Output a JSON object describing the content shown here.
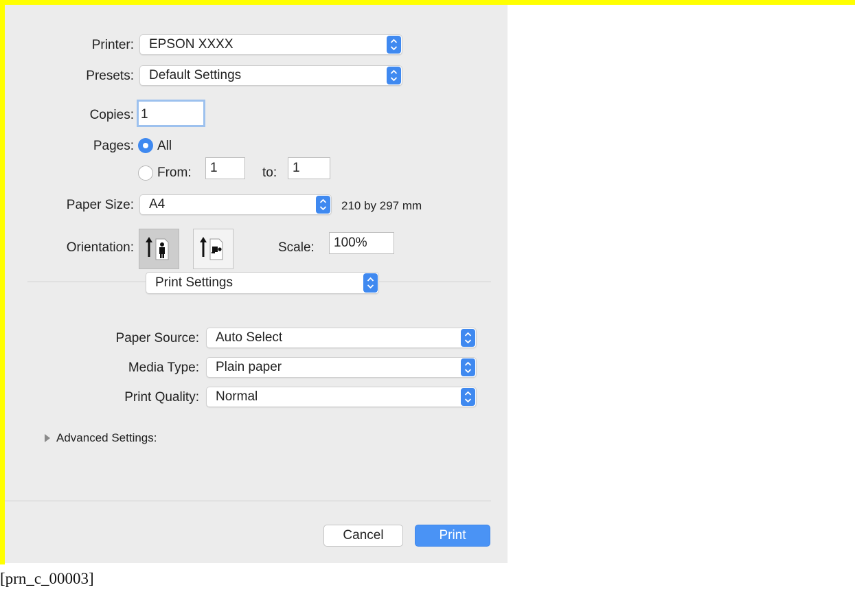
{
  "caption": "[prn_c_00003]",
  "printer": {
    "label": "Printer:",
    "value": "EPSON XXXX"
  },
  "presets": {
    "label": "Presets:",
    "value": "Default Settings"
  },
  "copies": {
    "label": "Copies:",
    "value": "1"
  },
  "pages": {
    "label": "Pages:",
    "all_label": "All",
    "from_label": "From:",
    "from_value": "1",
    "to_label": "to:",
    "to_value": "1",
    "selected": "All"
  },
  "paper_size": {
    "label": "Paper Size:",
    "value": "A4",
    "dimensions": "210 by 297 mm"
  },
  "orientation": {
    "label": "Orientation:",
    "selected": "portrait"
  },
  "scale": {
    "label": "Scale:",
    "value": "100%"
  },
  "section_menu": {
    "value": "Print Settings"
  },
  "paper_source": {
    "label": "Paper Source:",
    "value": "Auto Select"
  },
  "media_type": {
    "label": "Media Type:",
    "value": "Plain paper"
  },
  "print_quality": {
    "label": "Print Quality:",
    "value": "Normal"
  },
  "advanced": {
    "label": "Advanced Settings:"
  },
  "buttons": {
    "cancel": "Cancel",
    "print": "Print"
  },
  "colors": {
    "frame": "#ffff00",
    "accent": "#3f89f0",
    "dialog_bg": "#ececec"
  }
}
